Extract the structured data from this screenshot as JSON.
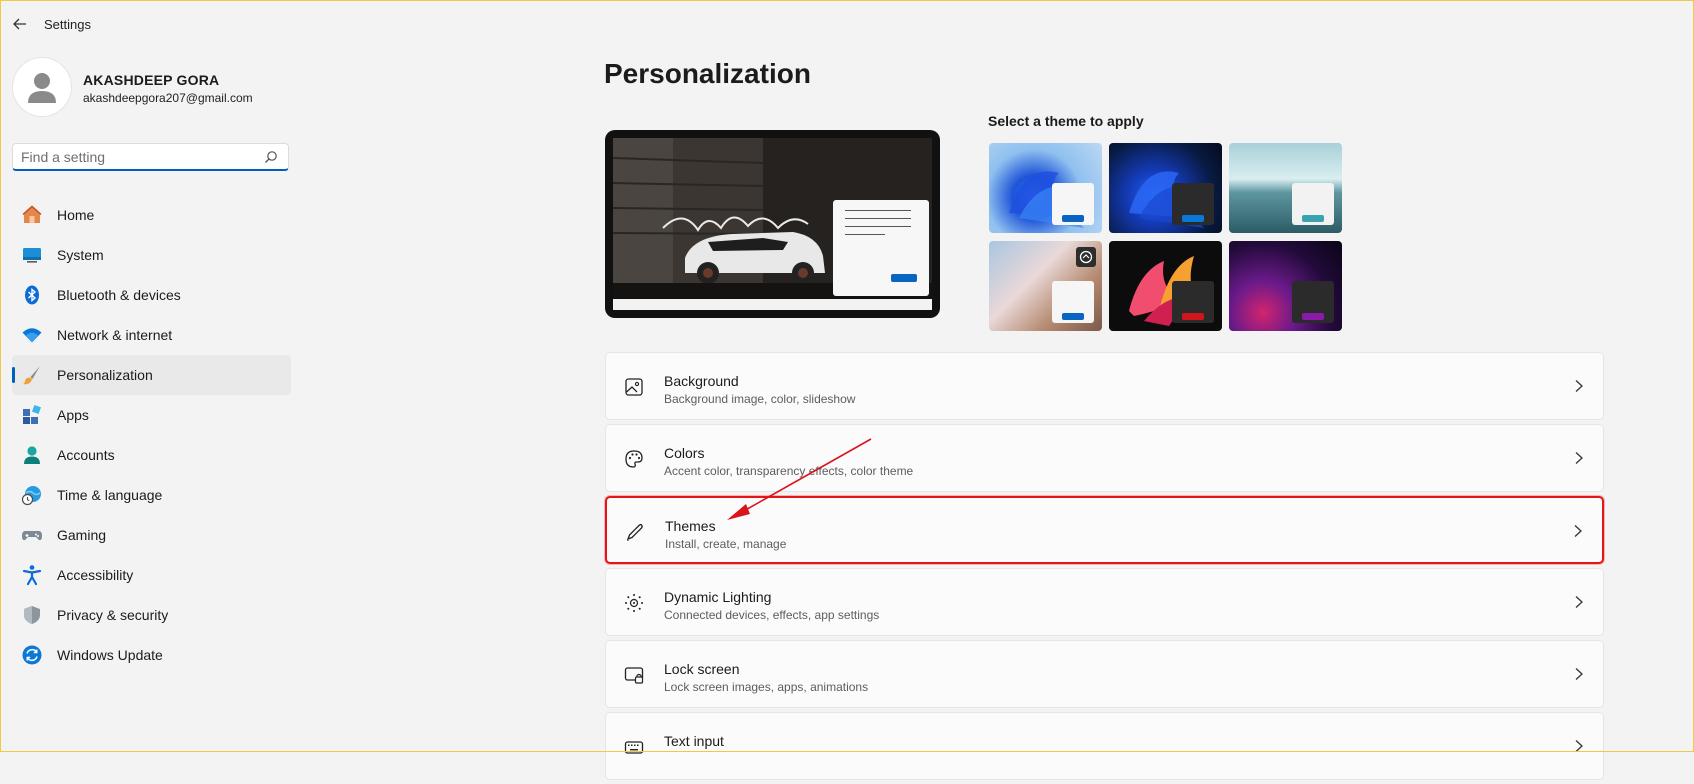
{
  "window": {
    "title": "Settings"
  },
  "profile": {
    "name": "AKASHDEEP GORA",
    "email": "akashdeepgora207@gmail.com"
  },
  "search": {
    "placeholder": "Find a setting"
  },
  "nav": {
    "items": [
      {
        "label": "Home",
        "icon": "home-icon"
      },
      {
        "label": "System",
        "icon": "system-icon"
      },
      {
        "label": "Bluetooth & devices",
        "icon": "bluetooth-icon"
      },
      {
        "label": "Network & internet",
        "icon": "wifi-icon"
      },
      {
        "label": "Personalization",
        "icon": "brush-icon",
        "active": true
      },
      {
        "label": "Apps",
        "icon": "apps-icon"
      },
      {
        "label": "Accounts",
        "icon": "accounts-icon"
      },
      {
        "label": "Time & language",
        "icon": "globe-clock-icon"
      },
      {
        "label": "Gaming",
        "icon": "gamepad-icon"
      },
      {
        "label": "Accessibility",
        "icon": "accessibility-icon"
      },
      {
        "label": "Privacy & security",
        "icon": "shield-icon"
      },
      {
        "label": "Windows Update",
        "icon": "update-icon"
      }
    ]
  },
  "main": {
    "title": "Personalization",
    "themes_label": "Select a theme to apply",
    "cards": [
      {
        "title": "Background",
        "subtitle": "Background image, color, slideshow",
        "icon": "image-icon"
      },
      {
        "title": "Colors",
        "subtitle": "Accent color, transparency effects, color theme",
        "icon": "palette-icon"
      },
      {
        "title": "Themes",
        "subtitle": "Install, create, manage",
        "icon": "pen-icon",
        "highlighted": true
      },
      {
        "title": "Dynamic Lighting",
        "subtitle": "Connected devices, effects, app settings",
        "icon": "lighting-icon"
      },
      {
        "title": "Lock screen",
        "subtitle": "Lock screen images, apps, animations",
        "icon": "lock-screen-icon"
      },
      {
        "title": "Text input",
        "subtitle": "",
        "icon": "keyboard-icon"
      }
    ]
  },
  "colors": {
    "accent": "#005fb8",
    "highlight": "#e0161b",
    "arrow": "#d9141a"
  }
}
